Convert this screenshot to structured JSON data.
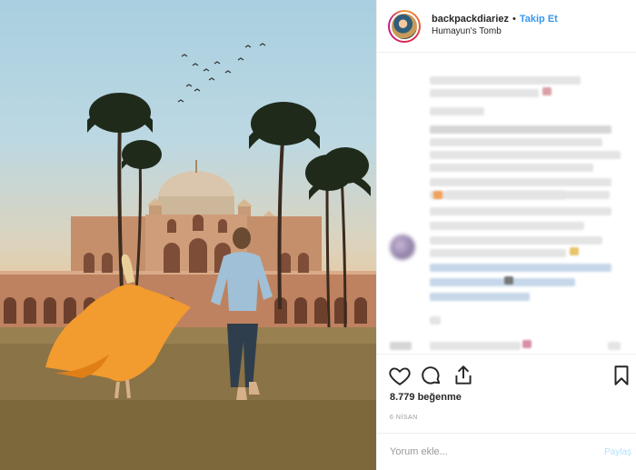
{
  "post": {
    "username": "backpackdiariez",
    "separator": "•",
    "follow_label": "Takip Et",
    "location": "Humayun's Tomb",
    "likes": "8.779 beğenme",
    "date": "6 NİSAN"
  },
  "comment_box": {
    "placeholder": "Yorum ekle...",
    "post_label": "Paylaş"
  },
  "icons": {
    "like": "heart-icon",
    "comment": "comment-bubble-icon",
    "share": "share-icon",
    "save": "bookmark-icon"
  },
  "colors": {
    "accent": "#3897f0",
    "post_disabled": "#b2dffc",
    "dress": "#f29b2e"
  }
}
